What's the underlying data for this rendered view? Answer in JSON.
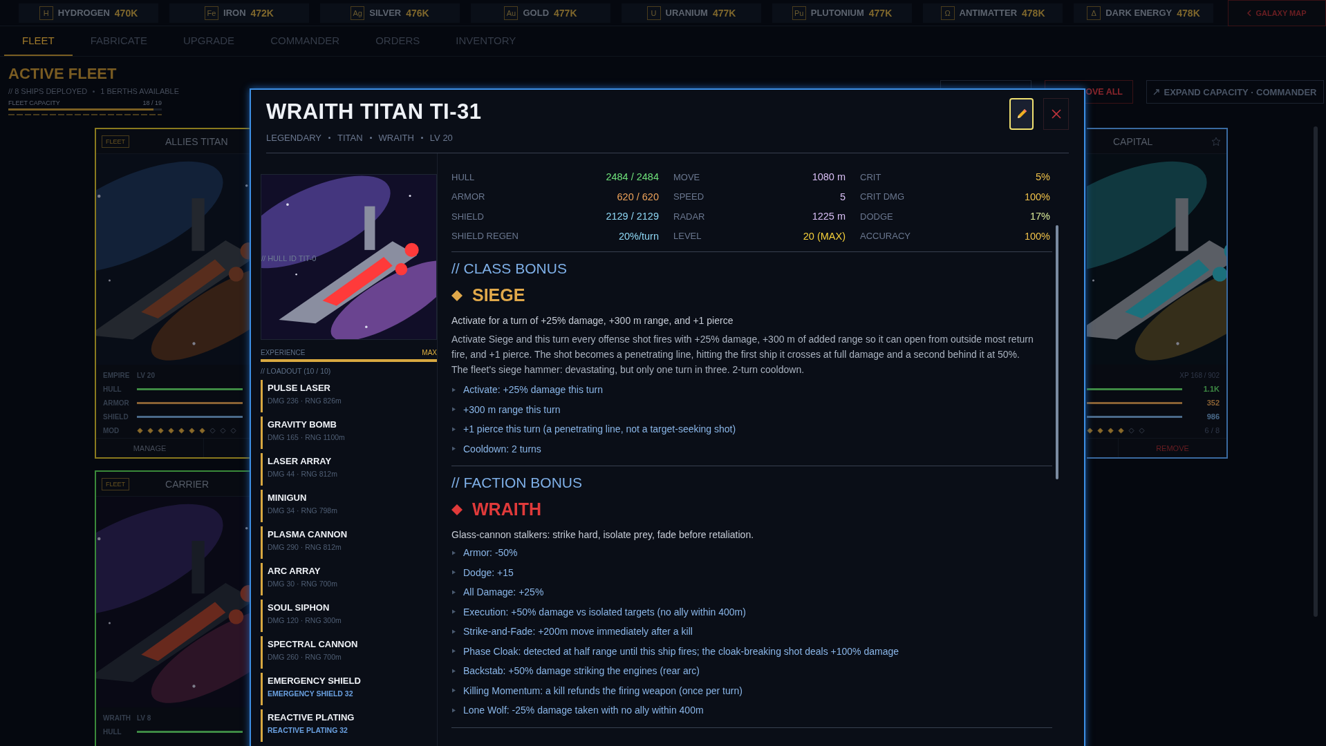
{
  "resources": [
    {
      "symbol": "H",
      "name": "HYDROGEN",
      "amount": "470K"
    },
    {
      "symbol": "Fe",
      "name": "IRON",
      "amount": "472K"
    },
    {
      "symbol": "Ag",
      "name": "SILVER",
      "amount": "476K"
    },
    {
      "symbol": "Au",
      "name": "GOLD",
      "amount": "477K"
    },
    {
      "symbol": "U",
      "name": "URANIUM",
      "amount": "477K"
    },
    {
      "symbol": "Pu",
      "name": "PLUTONIUM",
      "amount": "477K"
    },
    {
      "symbol": "Ω",
      "name": "ANTIMATTER",
      "amount": "478K"
    },
    {
      "symbol": "Δ",
      "name": "DARK ENERGY",
      "amount": "478K"
    }
  ],
  "galaxy_map_button": "GALAXY MAP",
  "tabs": [
    {
      "label": "FLEET",
      "selected": true
    },
    {
      "label": "FABRICATE",
      "selected": false
    },
    {
      "label": "UPGRADE",
      "selected": false
    },
    {
      "label": "COMMANDER",
      "selected": false
    },
    {
      "label": "ORDERS",
      "selected": false
    },
    {
      "label": "INVENTORY",
      "selected": false
    }
  ],
  "fleet": {
    "title": "ACTIVE FLEET",
    "summary": "// 8 SHIPS DEPLOYED",
    "berths": "1 BERTHS AVAILABLE",
    "capacity": {
      "label": "FLEET CAPACITY",
      "reading": "18 / 19",
      "level": 0.947
    },
    "actions": [
      {
        "label": "OVE ALL",
        "kind": "danger"
      },
      {
        "label": "EXPAND CAPACITY · COMMANDER",
        "kind": "expand"
      }
    ]
  },
  "left_ships": [
    {
      "tag": "FLEET",
      "name": "ALLIES TITAN",
      "color": "#8a7a1e",
      "faction": "EMPIRE",
      "lv": "LV 20",
      "stats": [
        {
          "label": "HULL",
          "color": "#3e8a44"
        },
        {
          "label": "ARMOR",
          "color": "#8a6234"
        },
        {
          "label": "SHIELD",
          "color": "#4a6a8a"
        }
      ],
      "mod_label": "MOD",
      "mod": [
        {
          "filled": true
        },
        {
          "filled": true
        },
        {
          "filled": true
        },
        {
          "filled": true
        },
        {
          "filled": true
        },
        {
          "filled": true
        },
        {
          "filled": true
        },
        {
          "filled": false
        },
        {
          "filled": false
        },
        {
          "filled": false
        }
      ],
      "actions": [
        "MANAGE"
      ]
    },
    {
      "tag": "FLEET",
      "name": "CARRIER",
      "color": "#3a8a3a",
      "faction": "WRAITH",
      "lv": "LV 8",
      "stats": [
        {
          "label": "HULL",
          "color": "#3e8a44"
        }
      ]
    }
  ],
  "right_ship": {
    "name": "CAPITAL",
    "color": "#3a6aa0",
    "favorite": false,
    "xp": "XP 168 / 902",
    "stats": [
      {
        "reading": "1.1K",
        "color": "#3e8a44"
      },
      {
        "reading": "352",
        "color": "#8a6234"
      },
      {
        "reading": "986",
        "color": "#4a6a8a"
      }
    ],
    "mod": [
      {
        "filled": true
      },
      {
        "filled": true
      },
      {
        "filled": true
      },
      {
        "filled": true
      },
      {
        "filled": false
      },
      {
        "filled": false
      }
    ],
    "mod_reading": "6 / 8",
    "actions": [
      "REMOVE"
    ]
  },
  "modal": {
    "title": "WRAITH TITAN TI-31",
    "tags": [
      "LEGENDARY",
      "TITAN",
      "WRAITH",
      "LV 20"
    ],
    "hull_id": "// HULL ID  TIT-0",
    "experience": {
      "label": "EXPERIENCE",
      "reading": "MAX",
      "level": 1
    },
    "loadout": {
      "label": "// LOADOUT  (10 / 10)",
      "items": [
        {
          "name": "PULSE LASER",
          "detail": "DMG 236 · RNG 826m",
          "kind": "weapon"
        },
        {
          "name": "GRAVITY BOMB",
          "detail": "DMG 165 · RNG 1100m",
          "kind": "weapon"
        },
        {
          "name": "LASER ARRAY",
          "detail": "DMG 44 · RNG 812m",
          "kind": "weapon"
        },
        {
          "name": "MINIGUN",
          "detail": "DMG 34 · RNG 798m",
          "kind": "weapon"
        },
        {
          "name": "PLASMA CANNON",
          "detail": "DMG 290 · RNG 812m",
          "kind": "weapon"
        },
        {
          "name": "ARC ARRAY",
          "detail": "DMG 30 · RNG 700m",
          "kind": "weapon"
        },
        {
          "name": "SOUL SIPHON",
          "detail": "DMG 120 · RNG 300m",
          "kind": "weapon"
        },
        {
          "name": "SPECTRAL CANNON",
          "detail": "DMG 260 · RNG 700m",
          "kind": "weapon"
        },
        {
          "name": "EMERGENCY SHIELD",
          "detail": "EMERGENCY SHIELD 32",
          "kind": "module"
        },
        {
          "name": "REACTIVE PLATING",
          "detail": "REACTIVE PLATING 32",
          "kind": "module"
        }
      ]
    },
    "stats": [
      {
        "label": "HULL",
        "value": "2484 / 2484",
        "color": "#6ee07a"
      },
      {
        "label": "MOVE",
        "value": "1080 m",
        "color": "#d9bff5"
      },
      {
        "label": "CRIT",
        "value": "5%",
        "color": "#f0c24a"
      },
      {
        "label": "ARMOR",
        "value": "620 / 620",
        "color": "#eea35a"
      },
      {
        "label": "SPEED",
        "value": "5",
        "color": "#d9bff5"
      },
      {
        "label": "CRIT DMG",
        "value": "100%",
        "color": "#f0c24a"
      },
      {
        "label": "SHIELD",
        "value": "2129 / 2129",
        "color": "#8fd8f5"
      },
      {
        "label": "RADAR",
        "value": "1225 m",
        "color": "#d9bff5"
      },
      {
        "label": "DODGE",
        "value": "17%",
        "color": "#dcec9a"
      },
      {
        "label": "SHIELD REGEN",
        "value": "20%/turn",
        "color": "#8fd8f5"
      },
      {
        "label": "LEVEL",
        "value": "20 (MAX)",
        "color": "#f5d03a"
      },
      {
        "label": "ACCURACY",
        "value": "100%",
        "color": "#f0c24a"
      }
    ],
    "bonuses": [
      {
        "heading": "// CLASS BONUS",
        "name": "SIEGE",
        "color": "#e0a84a",
        "summary": "Activate for a turn of +25% damage, +300 m range, and +1 pierce",
        "description": "Activate Siege and this turn every offense shot fires with +25% damage, +300 m of added range so it can open from outside most return fire, and +1 pierce. The shot becomes a penetrating line, hitting the first ship it crosses at full damage and a second behind it at 50%. The fleet's siege hammer: devastating, but only one turn in three. 2-turn cooldown.",
        "bullets": [
          "Activate: +25% damage this turn",
          "+300 m range this turn",
          "+1 pierce this turn (a penetrating line, not a target-seeking shot)",
          "Cooldown: 2 turns"
        ]
      },
      {
        "heading": "// FACTION BONUS",
        "name": "WRAITH",
        "color": "#e03a3a",
        "summary": "Glass-cannon stalkers: strike hard, isolate prey, fade before retaliation.",
        "bullets": [
          "Armor: -50%",
          "Dodge: +15",
          "All Damage: +25%",
          "Execution: +50% damage vs isolated targets (no ally within 400m)",
          "Strike-and-Fade: +200m move immediately after a kill",
          "Phase Cloak: detected at half range until this ship fires; the cloak-breaking shot deals +100% damage",
          "Backstab: +50% damage striking the engines (rear arc)",
          "Killing Momentum: a kill refunds the firing weapon (once per turn)",
          "Lone Wolf: -25% damage taken with no ally within 400m"
        ]
      }
    ]
  }
}
